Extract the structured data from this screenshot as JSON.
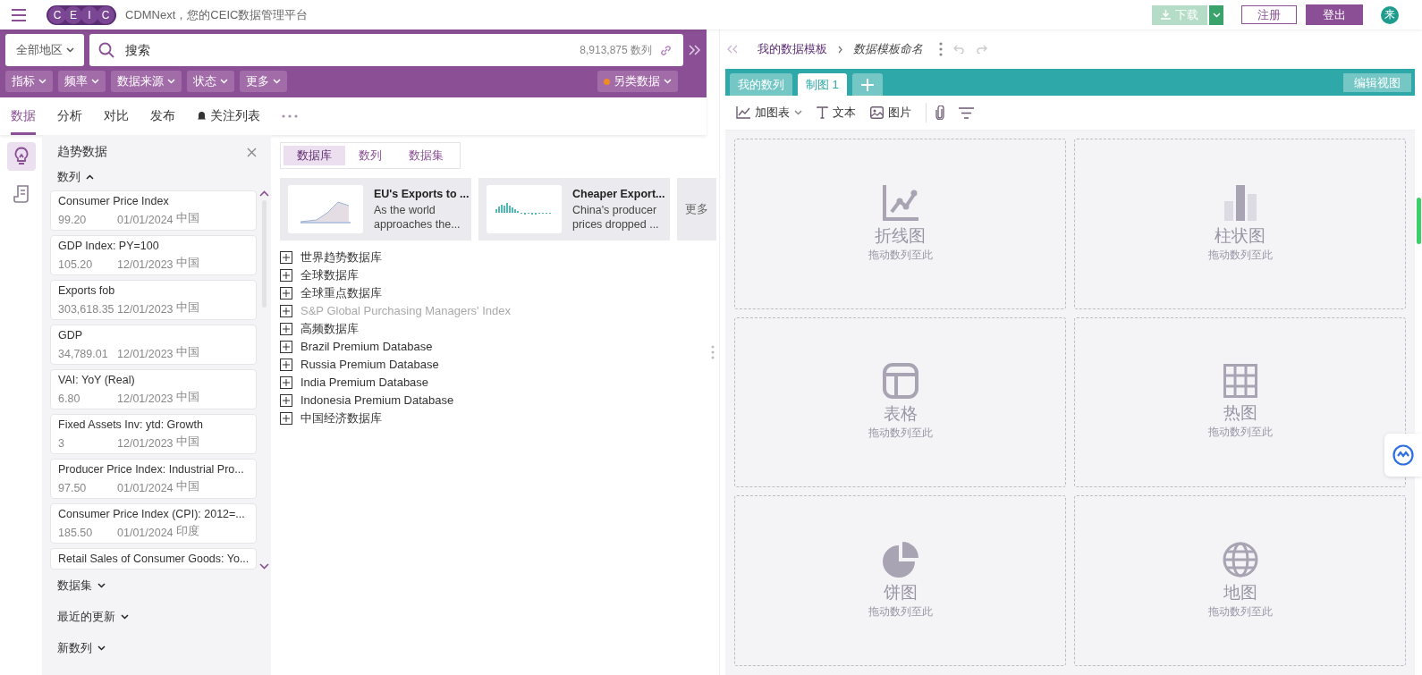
{
  "header": {
    "logo_letters": [
      "C",
      "E",
      "I",
      "C"
    ],
    "tagline": "CDMNext，您的CEIC数据管理平台",
    "download": {
      "label": "下载",
      "disabled": true
    },
    "register": "注册",
    "logout": "登出",
    "avatar": "来"
  },
  "search_bar": {
    "region": "全部地区",
    "placeholder": "搜索",
    "count": "8,913,875 数列"
  },
  "filters": [
    "指标",
    "频率",
    "数据来源",
    "状态",
    "更多"
  ],
  "alt_data": "另类数据",
  "tabs": [
    {
      "label": "数据",
      "selected": true
    },
    {
      "label": "分析",
      "selected": false
    },
    {
      "label": "对比",
      "selected": false
    },
    {
      "label": "发布",
      "selected": false
    },
    {
      "label": "关注列表",
      "selected": false
    }
  ],
  "rail": [
    {
      "kind": "bulb",
      "selected": true
    },
    {
      "kind": "doc",
      "selected": false
    }
  ],
  "sidebar": {
    "title": "趋势数据",
    "series_header": {
      "label": "数列",
      "expanded": true
    },
    "series": [
      {
        "name": "Consumer Price Index",
        "value": "99.20",
        "date": "01/01/2024",
        "region": "中国"
      },
      {
        "name": "GDP Index: PY=100",
        "value": "105.20",
        "date": "12/01/2023",
        "region": "中国"
      },
      {
        "name": "Exports fob",
        "value": "303,618.35",
        "date": "12/01/2023",
        "region": "中国"
      },
      {
        "name": "GDP",
        "value": "34,789.01",
        "date": "12/01/2023",
        "region": "中国"
      },
      {
        "name": "VAI: YoY (Real)",
        "value": "6.80",
        "date": "12/01/2023",
        "region": "中国"
      },
      {
        "name": "Fixed Assets Inv: ytd: Growth",
        "value": "3",
        "date": "12/01/2023",
        "region": "中国"
      },
      {
        "name": "Producer Price Index: Industrial Pro...",
        "value": "97.50",
        "date": "01/01/2024",
        "region": "中国"
      },
      {
        "name": "Consumer Price Index (CPI): 2012=...",
        "value": "185.50",
        "date": "01/01/2024",
        "region": "印度"
      },
      {
        "name": "Retail Sales of Consumer Goods: Yo..."
      }
    ],
    "sections": [
      {
        "label": "数据集",
        "expanded": false
      },
      {
        "label": "最近的更新",
        "expanded": false
      },
      {
        "label": "新数列",
        "expanded": false
      }
    ]
  },
  "segments": [
    {
      "label": "数据库",
      "selected": true
    },
    {
      "label": "数列",
      "selected": false
    },
    {
      "label": "数据集",
      "selected": false
    }
  ],
  "insights": [
    {
      "kind": "area",
      "title": "EU's Exports to ...",
      "lines": [
        "As the world",
        "approaches the..."
      ]
    },
    {
      "kind": "bars",
      "title": "Cheaper Export...",
      "lines": [
        "China's producer",
        "prices dropped ..."
      ]
    }
  ],
  "insights_more": "更多",
  "databases": [
    {
      "name": "世界趋势数据库",
      "disabled": false
    },
    {
      "name": "全球数据库",
      "disabled": false
    },
    {
      "name": "全球重点数据库",
      "disabled": false
    },
    {
      "name": "S&P Global Purchasing Managers' Index",
      "disabled": true
    },
    {
      "name": "高频数据库",
      "disabled": false
    },
    {
      "name": "Brazil Premium Database",
      "disabled": false
    },
    {
      "name": "Russia Premium Database",
      "disabled": false
    },
    {
      "name": "India Premium Database",
      "disabled": false
    },
    {
      "name": "Indonesia Premium Database",
      "disabled": false
    },
    {
      "name": "中国经济数据库",
      "disabled": false
    }
  ],
  "breadcrumb": {
    "parent": "我的数据模板",
    "current": "数据模板命名"
  },
  "view_tabs": [
    {
      "label": "我的数列",
      "selected": false
    },
    {
      "label": "制图 1",
      "selected": true
    }
  ],
  "edit_view": "编辑视图",
  "toolbar": [
    {
      "kind": "chart",
      "label": "加图表"
    },
    {
      "kind": "text",
      "label": "文本"
    },
    {
      "kind": "image",
      "label": "图片"
    },
    {
      "kind": "clip"
    },
    {
      "kind": "filter"
    }
  ],
  "tiles": [
    {
      "kind": "line",
      "title": "折线图",
      "hint": "拖动数列至此"
    },
    {
      "kind": "bar",
      "title": "柱状图",
      "hint": "拖动数列至此"
    },
    {
      "kind": "table",
      "title": "表格",
      "hint": "拖动数列至此"
    },
    {
      "kind": "heat",
      "title": "热图",
      "hint": "拖动数列至此"
    },
    {
      "kind": "pie",
      "title": "饼图",
      "hint": "拖动数列至此"
    },
    {
      "kind": "map",
      "title": "地图",
      "hint": "拖动数列至此"
    }
  ]
}
